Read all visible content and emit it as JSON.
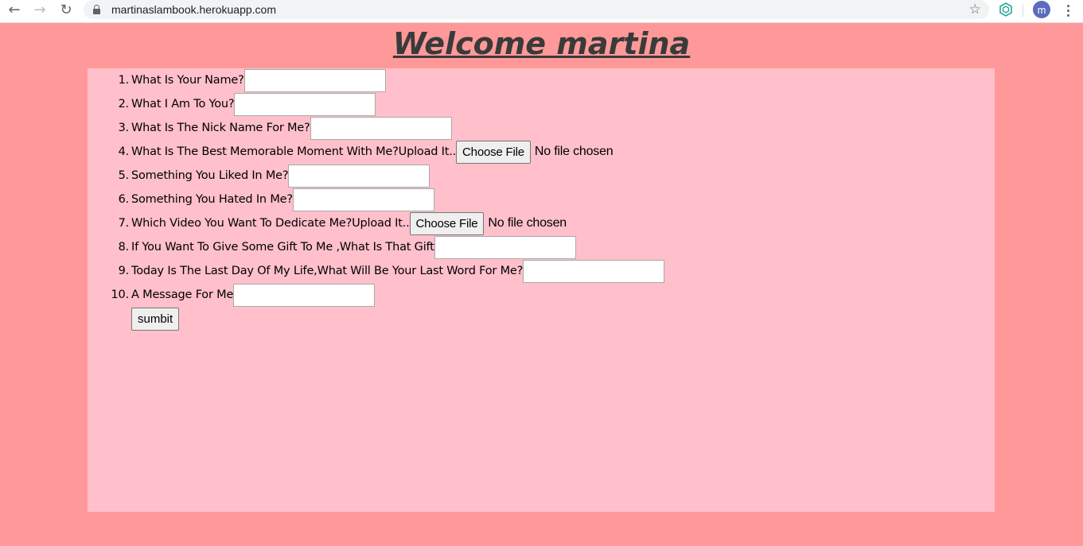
{
  "browser": {
    "url": "martinaslambook.herokuapp.com",
    "avatar_letter": "m",
    "icons": {
      "back": "arrow-left-icon",
      "forward": "arrow-right-icon",
      "reload": "reload-icon",
      "lock": "lock-icon",
      "bookmark": "star-icon",
      "extension": "extension-icon",
      "menu": "kebab-menu-icon"
    }
  },
  "page": {
    "title": "Welcome martina",
    "colors": {
      "background": "#ff9999",
      "panel": "#ffc0cb",
      "title": "#3a3a3a"
    }
  },
  "form": {
    "questions": [
      {
        "number": "1.",
        "label": "What Is Your Name?",
        "type": "text",
        "value": ""
      },
      {
        "number": "2.",
        "label": "What I Am To You?",
        "type": "text",
        "value": ""
      },
      {
        "number": "3.",
        "label": "What Is The Nick Name For Me?",
        "type": "text",
        "value": ""
      },
      {
        "number": "4.",
        "label": "What Is The Best Memorable Moment With Me?Upload It..",
        "type": "file",
        "button": "Choose File",
        "status": "No file chosen"
      },
      {
        "number": "5.",
        "label": "Something You Liked In Me?",
        "type": "text",
        "value": ""
      },
      {
        "number": "6.",
        "label": "Something You Hated In Me?",
        "type": "text",
        "value": ""
      },
      {
        "number": "7.",
        "label": "Which Video You Want To Dedicate Me?Upload It..",
        "type": "file",
        "button": "Choose File",
        "status": "No file chosen"
      },
      {
        "number": "8.",
        "label": "If You Want To Give Some Gift To Me ,What Is That Gift",
        "type": "text",
        "value": ""
      },
      {
        "number": "9.",
        "label": "Today Is The Last Day Of My Life,What Will Be Your Last Word For Me?",
        "type": "text",
        "value": ""
      },
      {
        "number": "10.",
        "label": "A Message For Me",
        "type": "text",
        "value": ""
      }
    ],
    "submit_label": "sumbit"
  }
}
